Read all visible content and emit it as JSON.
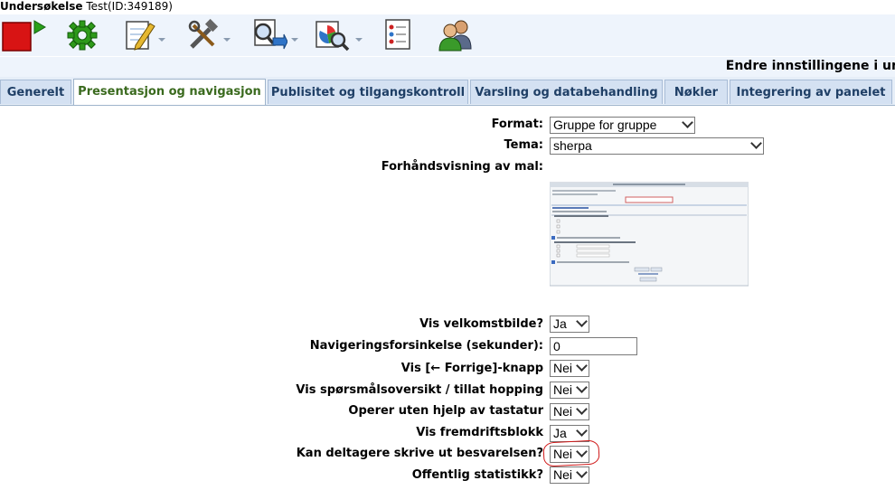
{
  "window": {
    "title_bold": "Undersøkelse",
    "title_rest": "Test(ID:349189)"
  },
  "toolbar": {
    "buttons": [
      {
        "name": "stop-icon"
      },
      {
        "name": "gear-icon"
      },
      {
        "name": "edit-icon"
      },
      {
        "name": "tools-icon"
      },
      {
        "name": "search-icon"
      },
      {
        "name": "chart-icon"
      },
      {
        "name": "list-icon"
      },
      {
        "name": "users-icon"
      }
    ]
  },
  "header": {
    "text": "Endre innstillingene i un"
  },
  "tabs": [
    {
      "label": "Generelt"
    },
    {
      "label": "Presentasjon og navigasjon"
    },
    {
      "label": "Publisitet og tilgangskontroll"
    },
    {
      "label": "Varsling og databehandling"
    },
    {
      "label": "Nøkler"
    },
    {
      "label": "Integrering av panelet"
    }
  ],
  "form": {
    "format": {
      "label": "Format:",
      "value": "Gruppe for gruppe"
    },
    "tema": {
      "label": "Tema:",
      "value": "sherpa"
    },
    "preview": {
      "label": "Forhåndsvisning av mal:"
    },
    "welcome": {
      "label": "Vis velkomstbilde?",
      "value": "Ja"
    },
    "nav_delay": {
      "label": "Navigeringsforsinkelse (sekunder):",
      "value": "0"
    },
    "prev_button": {
      "label": "Vis [← Forrige]-knapp",
      "value": "Nei"
    },
    "question_index": {
      "label": "Vis spørsmålsoversikt / tillat hopping",
      "value": "Nei"
    },
    "keyboard": {
      "label": "Operer uten hjelp av tastatur",
      "value": "Nei"
    },
    "progress": {
      "label": "Vis fremdriftsblokk",
      "value": "Ja"
    },
    "print": {
      "label": "Kan deltagere skrive ut besvarelsen?",
      "value": "Nei"
    },
    "public_stats": {
      "label": "Offentlig statistikk?",
      "value": "Nei"
    }
  }
}
